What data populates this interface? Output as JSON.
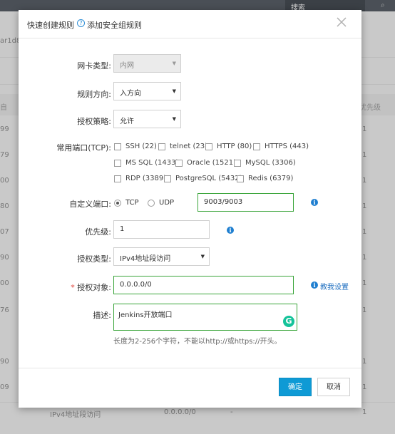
{
  "background": {
    "search_label": "搜索",
    "search_icon": "search-icon",
    "instance_id": "ar1d8",
    "priority_header": "优先级",
    "col0_header": "自",
    "row_numbers": [
      "99",
      "79",
      "00",
      "80",
      "07",
      "90",
      "00",
      "76",
      "90",
      "09"
    ],
    "row_priority": [
      "1",
      "1",
      "1",
      "1",
      "1",
      "1",
      "1",
      "1",
      "1",
      "1"
    ],
    "bottom_row": {
      "type": "IPv4地址段访问",
      "ip": "0.0.0.0/0",
      "dash": "-",
      "priority": "1"
    }
  },
  "modal": {
    "title": "快速创建规则",
    "help_icon": "?",
    "help_link": "添加安全组规则",
    "close_icon": "close-icon",
    "nic_type": {
      "label": "网卡类型:",
      "value": "内网"
    },
    "direction": {
      "label": "规则方向:",
      "value": "入方向"
    },
    "policy": {
      "label": "授权策略:",
      "value": "允许"
    },
    "common_ports": {
      "label": "常用端口(TCP):",
      "options": [
        "SSH (22)",
        "telnet (23)",
        "HTTP (80)",
        "HTTPS (443)",
        "MS SQL (1433)",
        "Oracle (1521)",
        "MySQL (3306)",
        "RDP (3389)",
        "PostgreSQL (5432)",
        "Redis (6379)"
      ]
    },
    "custom_port": {
      "label": "自定义端口:",
      "tcp": "TCP",
      "udp": "UDP",
      "value": "9003/9003",
      "selected": "TCP"
    },
    "priority": {
      "label": "优先级:",
      "value": "1"
    },
    "auth_type": {
      "label": "授权类型:",
      "value": "IPv4地址段访问"
    },
    "auth_object": {
      "required_mark": "*",
      "label": "授权对象:",
      "value": "0.0.0.0/0",
      "teach_link": "教我设置"
    },
    "description": {
      "label": "描述:",
      "value": "Jenkins开放端口",
      "hint": "长度为2-256个字符，不能以http://或https://开头。"
    },
    "info_glyph": "i",
    "grammarly_glyph": "G",
    "confirm_label": "确定",
    "cancel_label": "取消",
    "colors": {
      "primary": "#0e9ad5",
      "valid_border": "#3aa53a",
      "link": "#1f6fc0",
      "required": "#e0443b"
    }
  }
}
